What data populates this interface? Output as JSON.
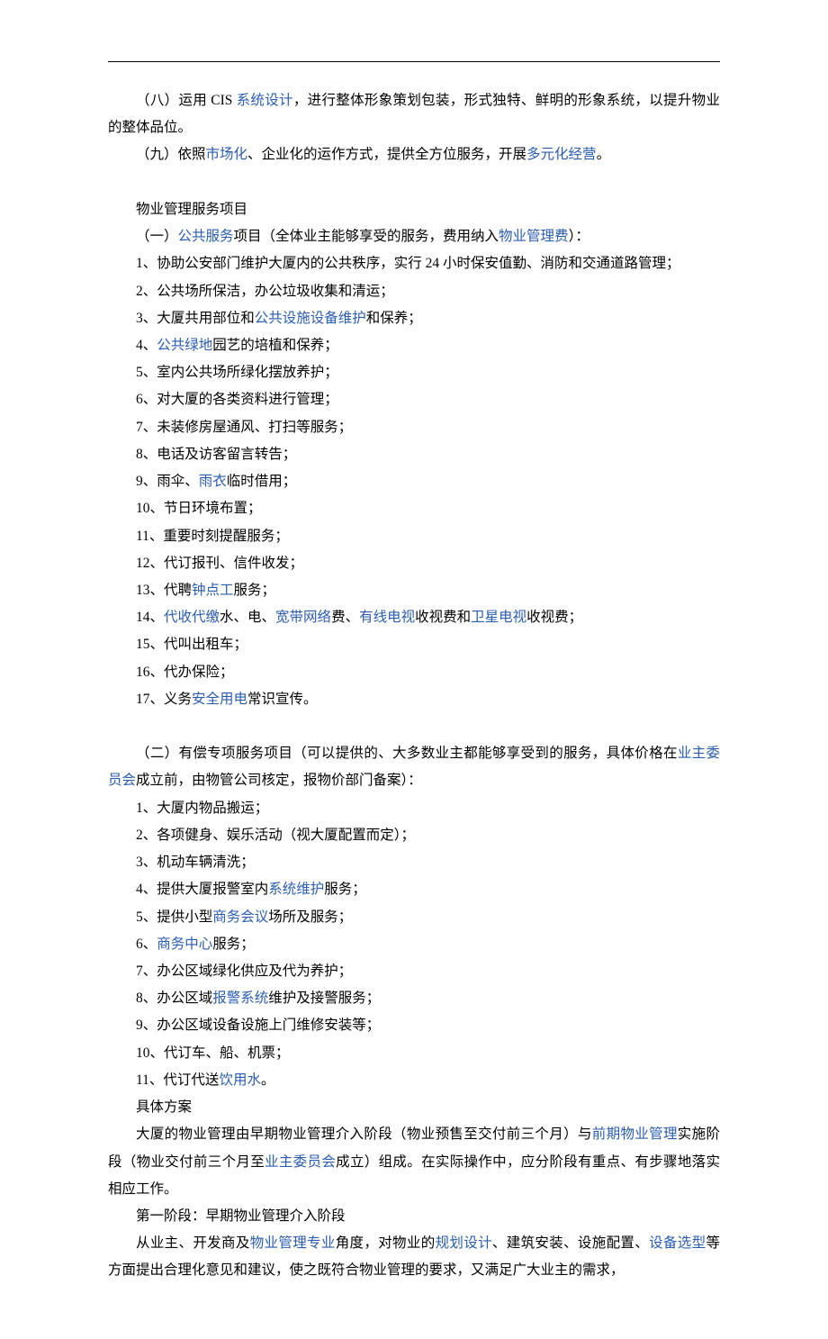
{
  "p8": {
    "t1": "（八）运用 CIS ",
    "l1": "系统设计",
    "t2": "，进行整体形象策划包装，形式独特、鲜明的形象系统，以提升物业的整体品位。"
  },
  "p9": {
    "t1": "（九）依照",
    "l1": "市场化",
    "t2": "、企业化的运作方式，提供全方位服务，开展",
    "l2": "多元化经营",
    "t3": "。"
  },
  "sec1_title": "物业管理服务项目",
  "sec1_head": {
    "t1": "（一）",
    "l1": "公共服务",
    "t2": "项目（全体业主能够享受的服务，费用纳入",
    "l2": "物业管理费",
    "t3": "）："
  },
  "a1": "1、协助公安部门维护大厦内的公共秩序，实行 24 小时保安值勤、消防和交通道路管理；",
  "a2": "2、公共场所保洁，办公垃圾收集和清运；",
  "a3": {
    "t1": "3、大厦共用部位和",
    "l1": "公共设施设备维护",
    "t2": "和保养；"
  },
  "a4": {
    "t1": "4、",
    "l1": "公共绿地",
    "t2": "园艺的培植和保养；"
  },
  "a5": "5、室内公共场所绿化摆放养护；",
  "a6": "6、对大厦的各类资料进行管理；",
  "a7": "7、未装修房屋通风、打扫等服务；",
  "a8": "8、电话及访客留言转告；",
  "a9": {
    "t1": "9、雨伞、",
    "l1": "雨衣",
    "t2": "临时借用；"
  },
  "a10": "10、节日环境布置；",
  "a11": "11、重要时刻提醒服务；",
  "a12": "12、代订报刊、信件收发；",
  "a13": {
    "t1": "13、代聘",
    "l1": "钟点工",
    "t2": "服务；"
  },
  "a14": {
    "t1": "14、",
    "l1": "代收代缴",
    "t2": "水、电、",
    "l2": "宽带网络",
    "t3": "费、",
    "l3": "有线电视",
    "t4": "收视费和",
    "l4": "卫星电视",
    "t5": "收视费；"
  },
  "a15": "15、代叫出租车；",
  "a16": "16、代办保险；",
  "a17": {
    "t1": "17、义务",
    "l1": "安全用电",
    "t2": "常识宣传。"
  },
  "sec2_head": {
    "t1": "（二）有偿专项服务项目（可以提供的、大多数业主都能够享受到的服务，具体价格在",
    "l1": "业主委员会",
    "t2": "成立前，由物管公司核定，报物价部门备案）："
  },
  "b1": "1、大厦内物品搬运；",
  "b2": "2、各项健身、娱乐活动（视大厦配置而定）；",
  "b3": "3、机动车辆清洗；",
  "b4": {
    "t1": "4、提供大厦报警室内",
    "l1": "系统维护",
    "t2": "服务；"
  },
  "b5": {
    "t1": "5、提供小型",
    "l1": "商务会议",
    "t2": "场所及服务；"
  },
  "b6": {
    "t1": "6、",
    "l1": "商务中心",
    "t2": "服务；"
  },
  "b7": "7、办公区域绿化供应及代为养护；",
  "b8": {
    "t1": "8、办公区域",
    "l1": "报警系统",
    "t2": "维护及接警服务；"
  },
  "b9": "9、办公区域设备设施上门维修安装等；",
  "b10": "10、代订车、船、机票；",
  "b11": {
    "t1": "11、代订代送",
    "l1": "饮用水",
    "t2": "。"
  },
  "plan_title": "具体方案",
  "plan_para": {
    "t1": "大厦的物业管理由早期物业管理介入阶段（物业预售至交付前三个月）与",
    "l1": "前期物业管理",
    "t2": "实施阶段（物业交付前三个月至",
    "l2": "业主委员会",
    "t3": "成立）组成。在实际操作中，应分阶段有重点、有步骤地落实相应工作。"
  },
  "stage1_title": "第一阶段：早期物业管理介入阶段",
  "stage1_para": {
    "t1": "从业主、开发商及",
    "l1": "物业管理专业",
    "t2": "角度，对物业的",
    "l2": "规划设计",
    "t3": "、建筑安装、设施配置、",
    "l3": "设备选型",
    "t4": "等方面提出合理化意见和建议，使之既符合物业管理的要求，又满足广大业主的需求，"
  }
}
